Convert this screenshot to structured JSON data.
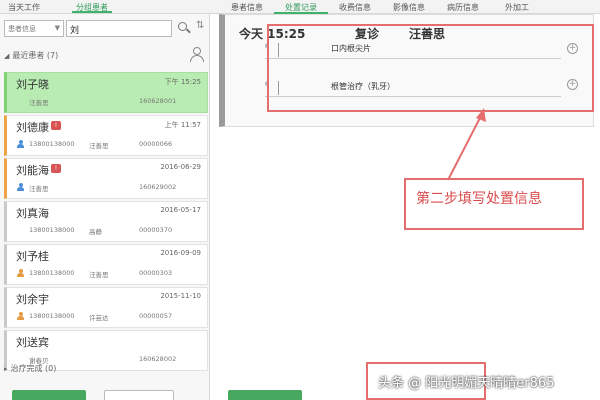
{
  "top_tabs_left": [
    {
      "label": "当天工作",
      "active": false
    },
    {
      "label": "分组患者",
      "active": true
    }
  ],
  "top_tabs_right": [
    {
      "label": "患者信息",
      "active": false
    },
    {
      "label": "处置记录",
      "active": true
    },
    {
      "label": "收费信息",
      "active": false
    },
    {
      "label": "影像信息",
      "active": false
    },
    {
      "label": "病历信息",
      "active": false
    },
    {
      "label": "外加工",
      "active": false
    }
  ],
  "search": {
    "scope": "患者信息",
    "query": "刘"
  },
  "sections": {
    "recent": "最近患者 (7)",
    "done": "治疗完成 (0)"
  },
  "patients": [
    {
      "name": "刘子晓",
      "flag": false,
      "date": "下午 15:25",
      "phone": "",
      "doctor": "汪善思",
      "id": "160628001",
      "icon": "",
      "selected": true,
      "bar": "green"
    },
    {
      "name": "刘德康",
      "flag": true,
      "date": "上午 11:57",
      "phone": "13800138000",
      "doctor": "汪善思",
      "id": "00000066",
      "icon": "blue",
      "selected": false,
      "bar": "orange"
    },
    {
      "name": "刘能海",
      "flag": true,
      "date": "2016-06-29",
      "phone": "",
      "doctor": "汪善思",
      "id": "160629002",
      "icon": "blue",
      "selected": false,
      "bar": "orange"
    },
    {
      "name": "刘真海",
      "flag": false,
      "date": "2016-05-17",
      "phone": "13800138000",
      "doctor": "高静",
      "id": "00000370",
      "icon": "",
      "selected": false,
      "bar": "gray"
    },
    {
      "name": "刘予桂",
      "flag": false,
      "date": "2016-09-09",
      "phone": "13800138000",
      "doctor": "汪善思",
      "id": "00000303",
      "icon": "orange",
      "selected": false,
      "bar": "gray"
    },
    {
      "name": "刘余宇",
      "flag": false,
      "date": "2015-11-10",
      "phone": "13800138000",
      "doctor": "许芸达",
      "id": "00000057",
      "icon": "orange",
      "selected": false,
      "bar": "gray"
    },
    {
      "name": "刘送宾",
      "flag": false,
      "date": "",
      "phone": "",
      "doctor": "谢春贝",
      "id": "160628002",
      "icon": "",
      "selected": false,
      "bar": "gray"
    }
  ],
  "record": {
    "time": "今天 15:25",
    "type": "复诊",
    "doctor": "汪善思",
    "items": [
      {
        "num": "6",
        "text": "口内根尖片"
      },
      {
        "num": "6",
        "text": "根管治疗（乳牙）"
      }
    ]
  },
  "annotations": {
    "step2": "第二步填写处置信息"
  },
  "watermark": "头条 @ 阳光明媚天晴晴er865",
  "colors": {
    "accent": "#3fb36b",
    "selected": "#b9ecb3",
    "highlight": "#e46e6e"
  }
}
